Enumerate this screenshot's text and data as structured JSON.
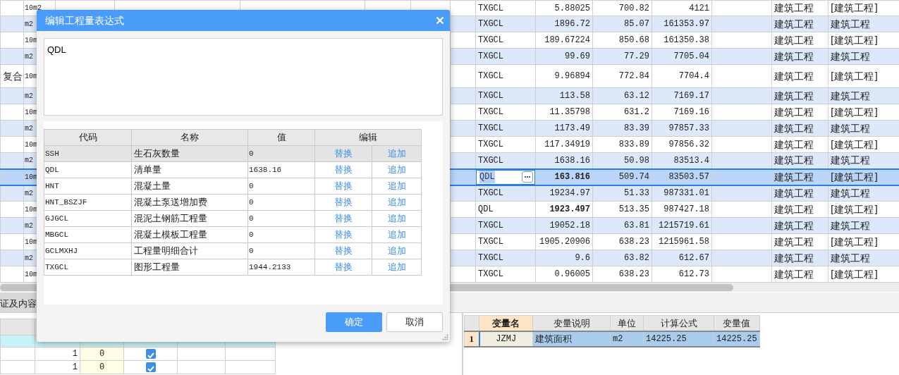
{
  "main_grid": {
    "rows": [
      {
        "column_2": "10m2",
        "column_3": "TXGCL",
        "column_4": "5.88025",
        "column_5": "700.82",
        "column_6": "4121",
        "column_7": "建筑工程",
        "column_8": "[建筑工程]",
        "selected": false
      },
      {
        "column_2": "m2",
        "column_3": "TXGCL",
        "column_4": "1896.72",
        "column_5": "85.07",
        "column_6": "161353.97",
        "column_7": "建筑工程",
        "column_8": "建筑工程",
        "selected": false
      },
      {
        "column_2": "10m",
        "column_3": "TXGCL",
        "column_4": "189.67224",
        "column_5": "850.68",
        "column_6": "161350.38",
        "column_7": "建筑工程",
        "column_8": "[建筑工程]",
        "selected": false
      },
      {
        "column_2": "m2",
        "column_3": "TXGCL",
        "column_4": "99.69",
        "column_5": "77.29",
        "column_6": "7705.04",
        "column_7": "建筑工程",
        "column_8": "建筑工程",
        "selected": false
      },
      {
        "column_1": "复合",
        "column_2": "10m",
        "column_3": "TXGCL",
        "column_4": "9.96894",
        "column_5": "772.84",
        "column_6": "7704.4",
        "column_7": "建筑工程",
        "column_8": "[建筑工程]",
        "selected": false,
        "tall": true
      },
      {
        "column_2": "m2",
        "column_3": "TXGCL",
        "column_4": "113.58",
        "column_5": "63.12",
        "column_6": "7169.17",
        "column_7": "建筑工程",
        "column_8": "建筑工程",
        "selected": false
      },
      {
        "column_2": "10m",
        "column_3": "TXGCL",
        "column_4": "11.35798",
        "column_5": "631.2",
        "column_6": "7169.16",
        "column_7": "建筑工程",
        "column_8": "[建筑工程]",
        "selected": false
      },
      {
        "column_2": "m2",
        "column_3": "TXGCL",
        "column_4": "1173.49",
        "column_5": "83.39",
        "column_6": "97857.33",
        "column_7": "建筑工程",
        "column_8": "建筑工程",
        "selected": false
      },
      {
        "column_2": "10m",
        "column_3": "TXGCL",
        "column_4": "117.34919",
        "column_5": "833.89",
        "column_6": "97856.32",
        "column_7": "建筑工程",
        "column_8": "[建筑工程]",
        "selected": false
      },
      {
        "column_2": "m2",
        "column_3": "TXGCL",
        "column_4": "1638.16",
        "column_5": "50.98",
        "column_6": "83513.4",
        "column_7": "建筑工程",
        "column_8": "建筑工程",
        "selected": false
      },
      {
        "column_2": "10m",
        "column_3": "QDL",
        "column_4": "163.816",
        "column_5": "509.74",
        "column_6": "83503.57",
        "column_7": "建筑工程",
        "column_8": "[建筑工程]",
        "selected": true,
        "editing": true,
        "column_4_bold": true
      },
      {
        "column_2": "m2",
        "column_3": "TXGCL",
        "column_4": "19234.97",
        "column_5": "51.33",
        "column_6": "987331.01",
        "column_7": "建筑工程",
        "column_8": "建筑工程",
        "selected": false
      },
      {
        "column_2": "10m",
        "column_3": "QDL",
        "column_4": "1923.497",
        "column_5": "513.35",
        "column_6": "987427.18",
        "column_7": "建筑工程",
        "column_8": "[建筑工程]",
        "selected": false,
        "column_4_bold": true
      },
      {
        "column_2": "m2",
        "column_3": "TXGCL",
        "column_4": "19052.18",
        "column_5": "63.81",
        "column_6": "1215719.61",
        "column_7": "建筑工程",
        "column_8": "建筑工程",
        "selected": false
      },
      {
        "column_2": "10m",
        "column_3": "TXGCL",
        "column_4": "1905.20906",
        "column_5": "638.23",
        "column_6": "1215961.58",
        "column_7": "建筑工程",
        "column_8": "[建筑工程]",
        "selected": false
      },
      {
        "column_2": "m2",
        "column_3": "TXGCL",
        "column_4": "9.6",
        "column_5": "63.82",
        "column_6": "612.67",
        "column_7": "建筑工程",
        "column_8": "建筑工程",
        "selected": false
      },
      {
        "column_2": "10m",
        "column_3": "TXGCL",
        "column_4": "0.96005",
        "column_5": "638.23",
        "column_6": "612.73",
        "column_7": "建筑工程",
        "column_8": "[建筑工程]",
        "selected": false
      }
    ]
  },
  "bottom_tab": {
    "label": "证及内容"
  },
  "bottom_left_grid": {
    "rows": [
      {
        "selected": true
      },
      {
        "column_2": "1",
        "column_3": "0",
        "checked": true,
        "selected": false
      },
      {
        "column_2": "1",
        "column_3": "0",
        "checked": true,
        "selected": false
      }
    ]
  },
  "variables_grid": {
    "columns": [
      "变量名",
      "变量说明",
      "单位",
      "计算公式",
      "变量值"
    ],
    "rows": [
      {
        "index": "1",
        "name": "JZMJ",
        "description": "建筑面积",
        "unit": "m2",
        "formula": "14225.25",
        "value": "14225.25",
        "selected": true
      }
    ]
  },
  "dialog": {
    "title": "编辑工程量表达式",
    "expression": {
      "value": "QDL"
    },
    "table": {
      "columns": [
        "代码",
        "名称",
        "值",
        "编辑"
      ],
      "rows": [
        {
          "code": "SSH",
          "name": "生石灰数量",
          "value": "0",
          "actions": [
            "替换",
            "追加"
          ],
          "selected": true
        },
        {
          "code": "QDL",
          "name": "清单量",
          "value": "1638.16",
          "actions": [
            "替换",
            "追加"
          ],
          "selected": false
        },
        {
          "code": "HNT",
          "name": "混凝土量",
          "value": "0",
          "actions": [
            "替换",
            "追加"
          ],
          "selected": false
        },
        {
          "code": "HNT_BSZJF",
          "name": "混凝土泵送增加费",
          "value": "0",
          "actions": [
            "替换",
            "追加"
          ],
          "selected": false
        },
        {
          "code": "GJGCL",
          "name": "混泥土钢筋工程量",
          "value": "0",
          "actions": [
            "替换",
            "追加"
          ],
          "selected": false
        },
        {
          "code": "MBGCL",
          "name": "混凝土模板工程量",
          "value": "0",
          "actions": [
            "替换",
            "追加"
          ],
          "selected": false
        },
        {
          "code": "GCLMXHJ",
          "name": "工程量明细合计",
          "value": "0",
          "actions": [
            "替换",
            "追加"
          ],
          "selected": false
        },
        {
          "code": "TXGCL",
          "name": "图形工程量",
          "value": "1944.2133",
          "actions": [
            "替换",
            "追加"
          ],
          "selected": false
        }
      ]
    },
    "buttons": [
      {
        "label": "确定",
        "kind": "primary"
      },
      {
        "label": "取消",
        "kind": "secondary"
      }
    ]
  }
}
